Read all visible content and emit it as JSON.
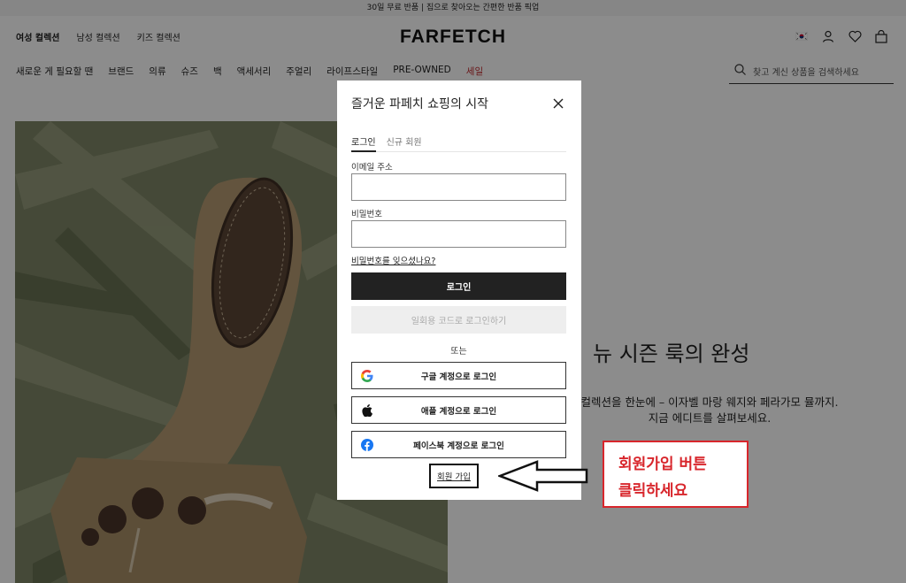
{
  "promo": "30일 무료 반품 | 집으로 찾아오는 간편한 반품 픽업",
  "header": {
    "gender_tabs": [
      "여성 컬렉션",
      "남성 컬렉션",
      "키즈 컬렉션"
    ],
    "logo": "FARFETCH",
    "icons": [
      "korea-flag-icon",
      "user-icon",
      "heart-icon",
      "bag-icon"
    ]
  },
  "categories": [
    "새로운 게 필요할 땐",
    "브랜드",
    "의류",
    "슈즈",
    "백",
    "액세서리",
    "주얼리",
    "라이프스타일",
    "PRE-OWNED",
    "세일"
  ],
  "search": {
    "placeholder": "찾고 계신 상품을 검색하세요"
  },
  "hero": {
    "title": "뉴 시즌 룩의 완성",
    "desc_line1": "컬렉션을 한눈에 – 이자벨 마랑 웨지와 페라가모 뮬까지.",
    "desc_line2": "지금 에디트를 살펴보세요."
  },
  "modal": {
    "title": "즐거운 파페치 쇼핑의 시작",
    "tabs": [
      "로그인",
      "신규 회원"
    ],
    "email_label": "이메일 주소",
    "password_label": "비밀번호",
    "forgot": "비밀번호를 잊으셨나요?",
    "login_button": "로그인",
    "otp_button": "일회용 코드로 로그인하기",
    "or": "또는",
    "google": "구글 계정으로 로그인",
    "apple": "애플 계정으로 로그인",
    "facebook": "페이스북 계정으로 로그인",
    "signup": "회원 가입"
  },
  "annotation": {
    "line1": "회원가입 버튼",
    "line2": "클릭하세요"
  },
  "colors": {
    "sale": "#c0282d",
    "callout": "#d8262c",
    "dark_button": "#222222"
  }
}
